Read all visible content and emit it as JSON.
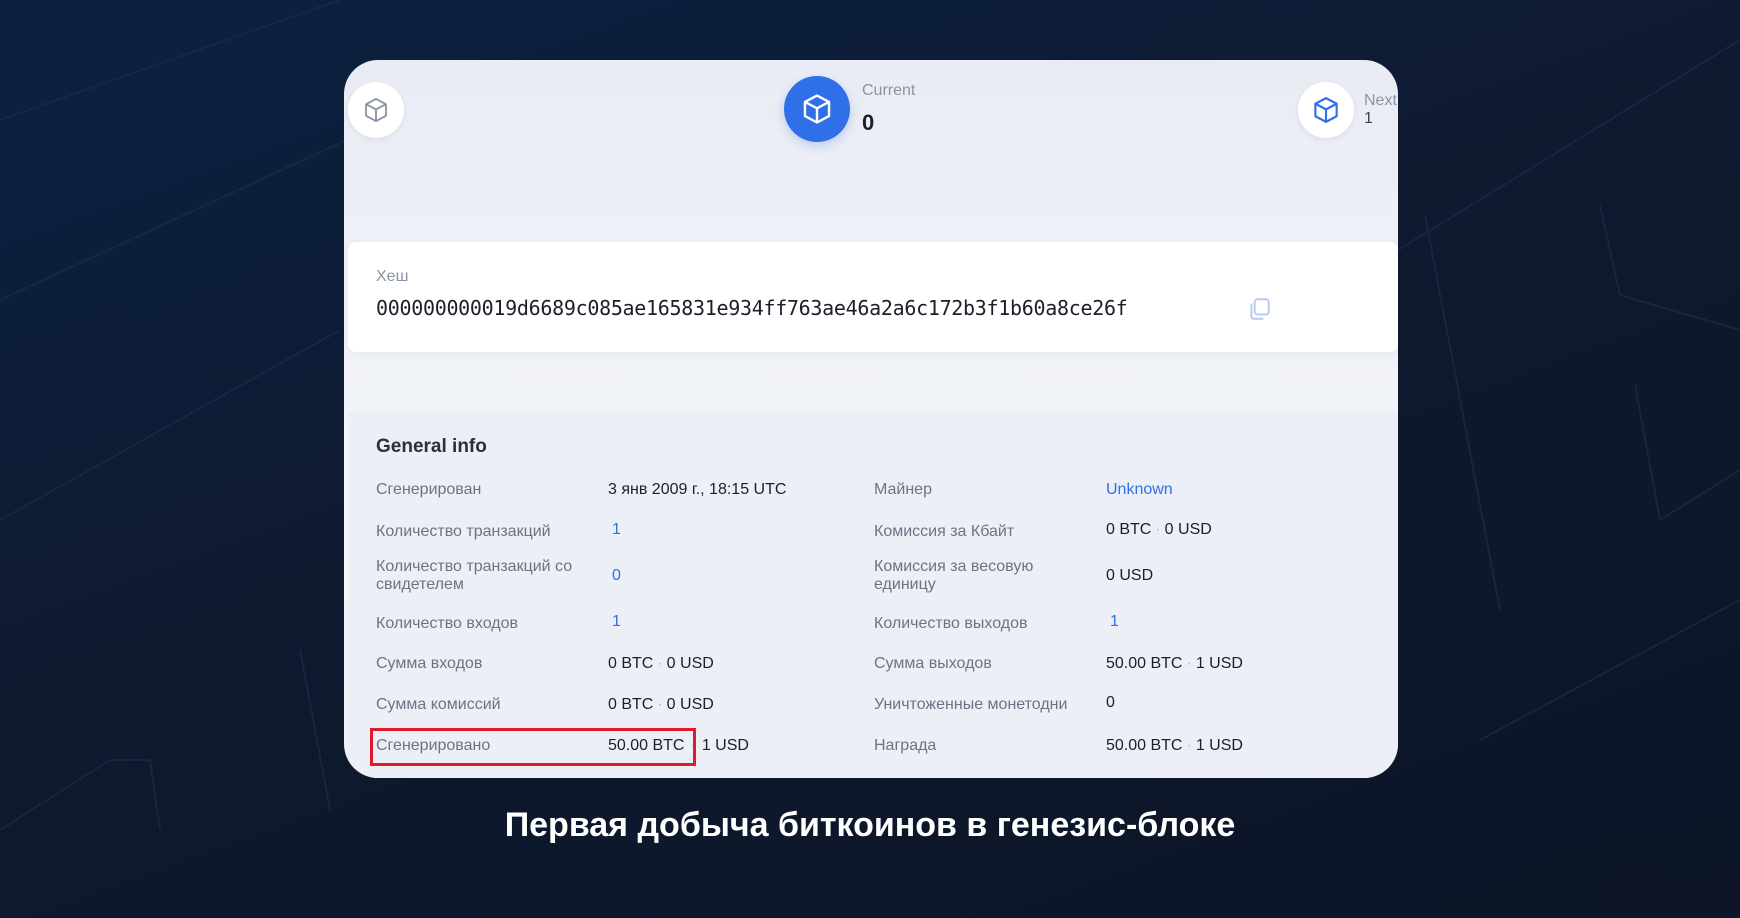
{
  "nav": {
    "current_label": "Current",
    "current_value": "0",
    "next_label": "Next",
    "next_value": "1",
    "icon": "cube-icon"
  },
  "hash": {
    "label": "Хеш",
    "value": "000000000019d6689c085ae165831e934ff763ae46a2a6c172b3f1b60a8ce26f"
  },
  "general": {
    "title": "General info",
    "left": [
      {
        "label": "Сгенерирован",
        "value": "3 янв 2009 г., 18:15 UTC",
        "link": false
      },
      {
        "label": "Количество транзакций",
        "value": "1",
        "link": true
      },
      {
        "label": "Количество транзакций со свидетелем",
        "value": "0",
        "link": true
      },
      {
        "label": "Количество входов",
        "value": "1",
        "link": true
      },
      {
        "label": "Сумма входов",
        "value": "0 BTC",
        "value2": "0 USD"
      },
      {
        "label": "Сумма комиссий",
        "value": "0 BTC",
        "value2": "0 USD"
      },
      {
        "label": "Сгенерировано",
        "value": "50.00 BTC",
        "value2": "1 USD"
      }
    ],
    "right": [
      {
        "label": "Майнер",
        "value": "Unknown",
        "link": true
      },
      {
        "label": "Комиссия за Кбайт",
        "value": "0 BTC",
        "value2": "0 USD"
      },
      {
        "label": "Комиссия за весовую единицу",
        "value": "0 USD",
        "link": false
      },
      {
        "label": "Количество выходов",
        "value": "1",
        "link": true
      },
      {
        "label": "Сумма выходов",
        "value": "50.00 BTC",
        "value2": "1 USD"
      },
      {
        "label": "Уничтоженные монетодни",
        "value": "0",
        "link": false
      },
      {
        "label": "Награда",
        "value": "50.00 BTC",
        "value2": "1 USD"
      }
    ]
  },
  "caption": "Первая добыча биткоинов в генезис-блоке",
  "colors": {
    "accent": "#2f6fe8",
    "highlight": "#e0192b"
  }
}
